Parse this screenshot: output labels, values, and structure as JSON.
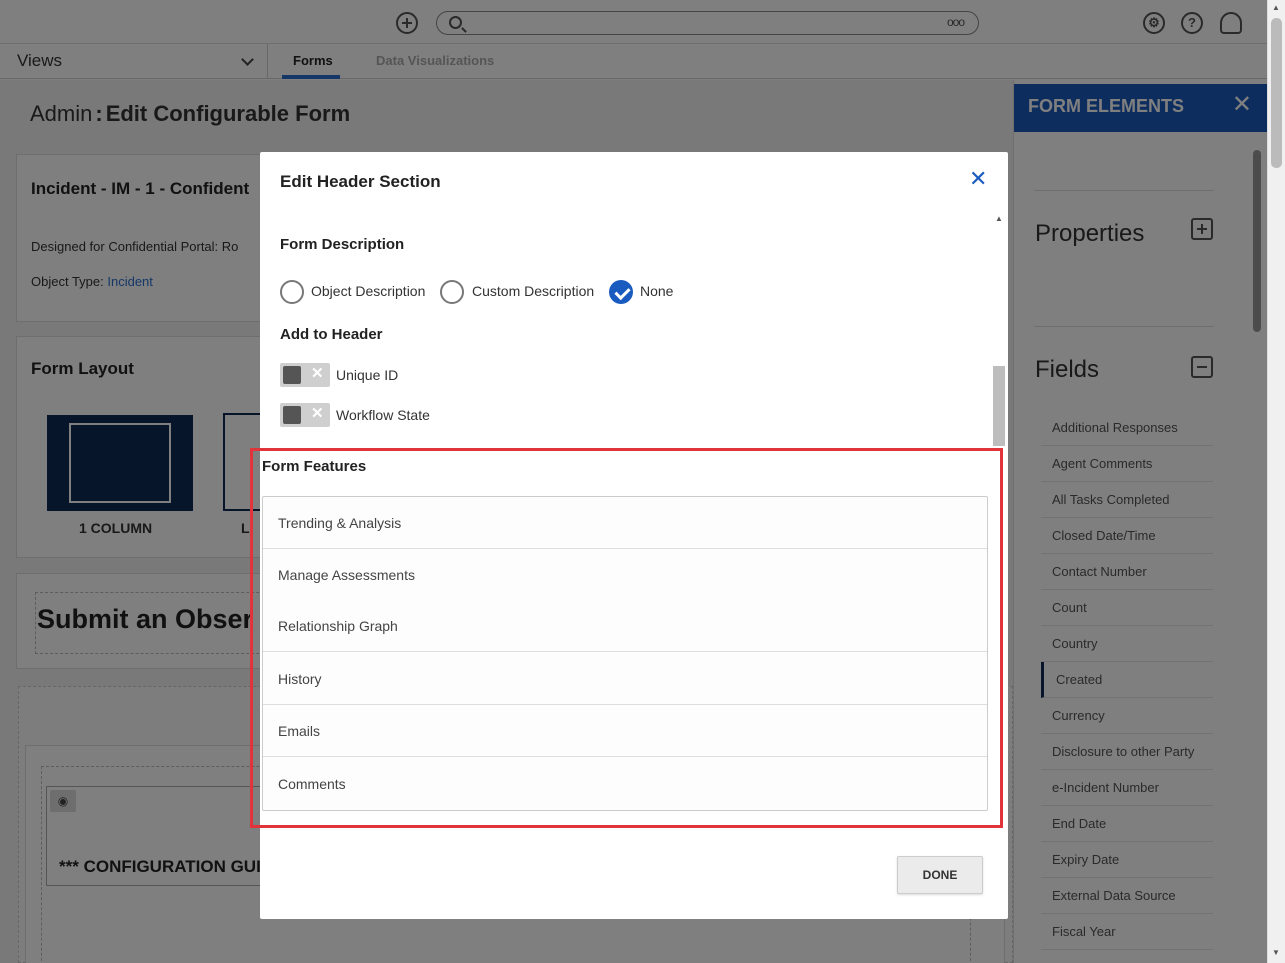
{
  "topbar": {
    "search_more": "ooo",
    "help_glyph": "?"
  },
  "nav": {
    "views_label": "Views",
    "tabs": [
      {
        "label": "Forms",
        "active": true
      },
      {
        "label": "Data Visualizations",
        "active": false
      }
    ]
  },
  "page": {
    "title_prefix": "Admin",
    "title_sep": ":",
    "title_main": "Edit Configurable Form",
    "incident_title": "Incident - IM - 1 - Confident",
    "designed_for": "Designed for Confidential Portal: Ro",
    "object_type_label": "Object Type: ",
    "object_type_value": "Incident",
    "form_layout_title": "Form Layout",
    "layout_options": [
      "1 COLUMN",
      "L"
    ],
    "submit_title": "Submit an Obser",
    "guidance": "*** CONFIGURATION GUIDANCE - DO NOT REMOVE SECTION ***"
  },
  "right_panel": {
    "title": "FORM ELEMENTS",
    "close_glyph": "✕",
    "properties_label": "Properties",
    "fields_label": "Fields",
    "fields": [
      "Additional Responses",
      "Agent Comments",
      "All Tasks Completed",
      "Closed Date/Time",
      "Contact Number",
      "Count",
      "Country",
      "Created",
      "Currency",
      "Disclosure to other Party",
      "e-Incident Number",
      "End Date",
      "Expiry Date",
      "External Data Source",
      "Fiscal Year"
    ],
    "active_field": "Created"
  },
  "modal": {
    "title": "Edit Header Section",
    "close_glyph": "✕",
    "form_description_label": "Form Description",
    "description_options": [
      {
        "label": "Object Description",
        "selected": false
      },
      {
        "label": "Custom Description",
        "selected": false
      },
      {
        "label": "None",
        "selected": true
      }
    ],
    "add_to_header_label": "Add to Header",
    "header_toggles": [
      {
        "label": "Unique ID",
        "enabled": false
      },
      {
        "label": "Workflow State",
        "enabled": false
      }
    ],
    "form_features_label": "Form Features",
    "features": [
      "Trending & Analysis",
      "Manage Assessments",
      "Relationship Graph",
      "History",
      "Emails",
      "Comments"
    ],
    "done_label": "DONE"
  },
  "colors": {
    "accent_blue": "#1a5bbf",
    "navy": "#0f2a57",
    "highlight_red": "#e0333a"
  }
}
